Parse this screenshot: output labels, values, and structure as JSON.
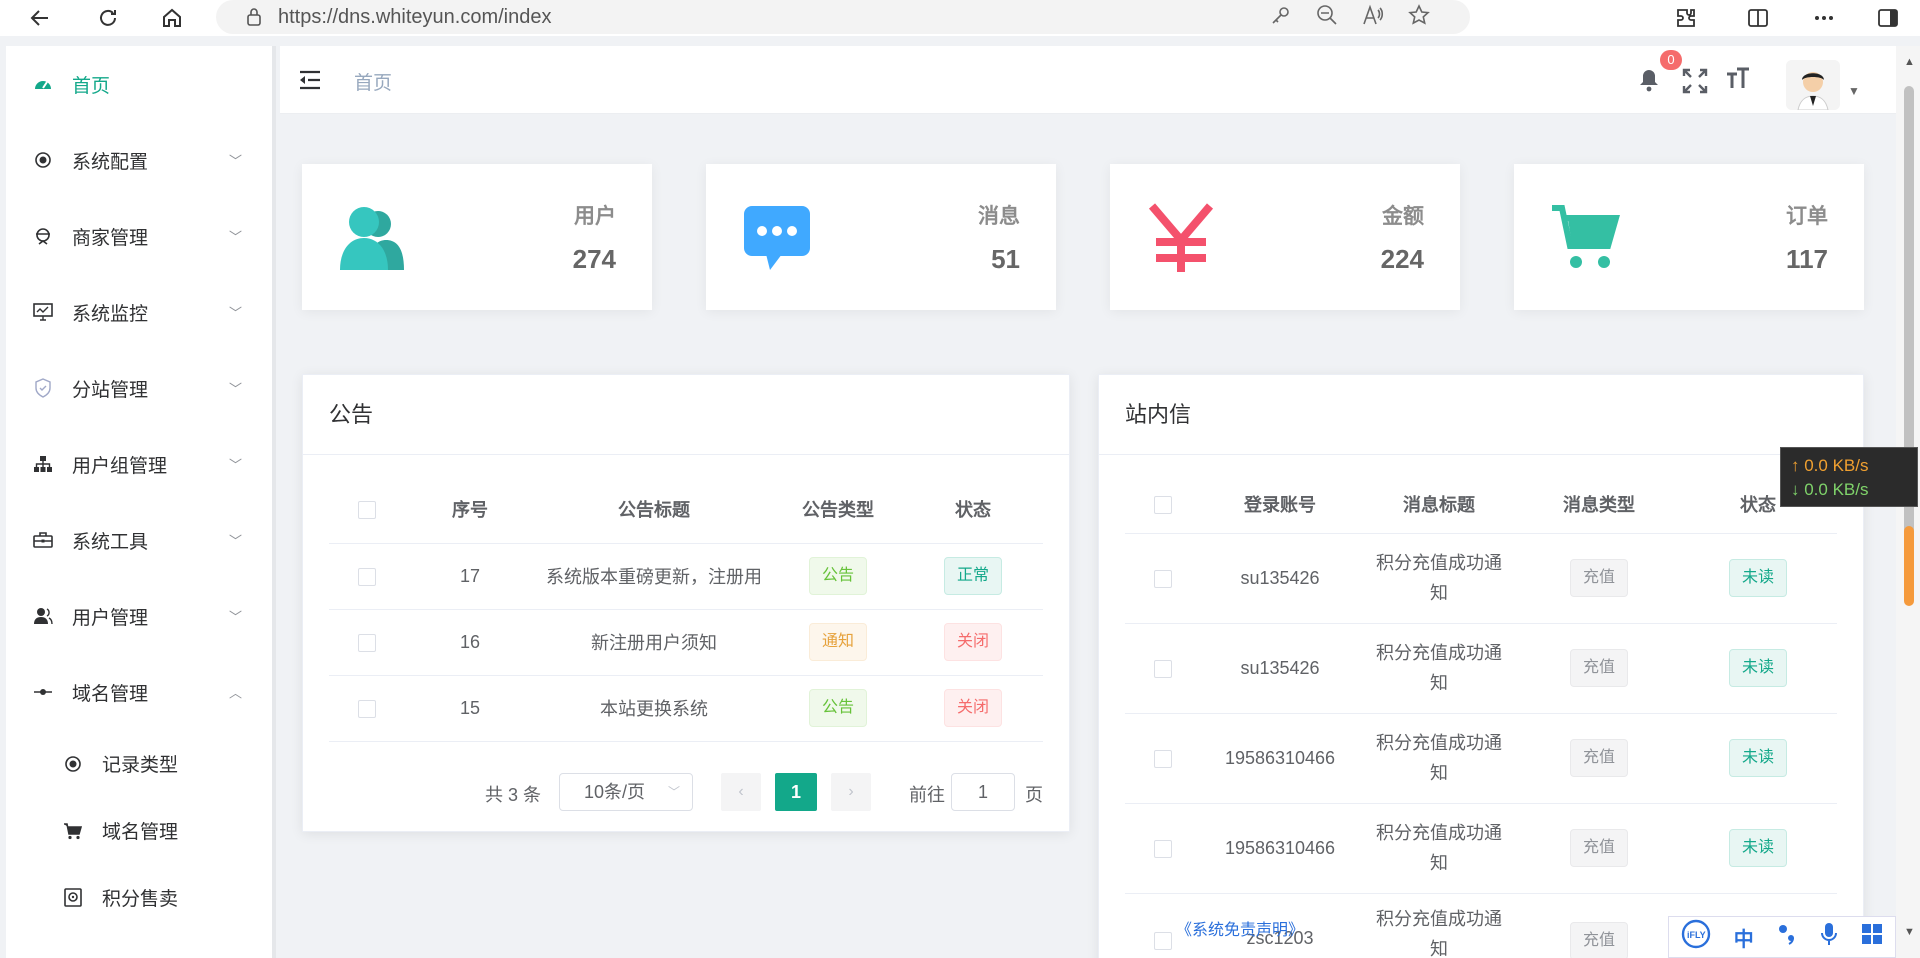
{
  "browser": {
    "url": "https://dns.whiteyun.com/index"
  },
  "sidebar": {
    "items": [
      {
        "label": "首页",
        "icon": "dashboard-icon",
        "active": true
      },
      {
        "label": "系统配置",
        "icon": "settings-dot-icon"
      },
      {
        "label": "商家管理",
        "icon": "merchant-icon"
      },
      {
        "label": "系统监控",
        "icon": "monitor-icon"
      },
      {
        "label": "分站管理",
        "icon": "shield-icon"
      },
      {
        "label": "用户组管理",
        "icon": "org-tree-icon"
      },
      {
        "label": "系统工具",
        "icon": "toolbox-icon"
      },
      {
        "label": "用户管理",
        "icon": "user-icon"
      },
      {
        "label": "域名管理",
        "icon": "domain-icon",
        "expanded": true
      }
    ],
    "subitems": [
      {
        "label": "记录类型",
        "icon": "radio-dot-icon"
      },
      {
        "label": "域名管理",
        "icon": "cart-icon"
      },
      {
        "label": "积分售卖",
        "icon": "safe-icon"
      }
    ]
  },
  "topbar": {
    "breadcrumb": "首页",
    "notification_count": "0"
  },
  "stats": [
    {
      "label": "用户",
      "value": "274",
      "icon": "users-icon",
      "color": "#36c6bf"
    },
    {
      "label": "消息",
      "value": "51",
      "icon": "message-icon",
      "color": "#40a9ff"
    },
    {
      "label": "金额",
      "value": "224",
      "icon": "yen-icon",
      "color": "#f4516c"
    },
    {
      "label": "订单",
      "value": "117",
      "icon": "shopping-cart-icon",
      "color": "#34bfa3"
    }
  ],
  "announcements": {
    "title": "公告",
    "columns": [
      "序号",
      "公告标题",
      "公告类型",
      "状态"
    ],
    "rows": [
      {
        "id": "17",
        "title": "系统版本重磅更新，注册用",
        "type": "公告",
        "status": "正常"
      },
      {
        "id": "16",
        "title": "新注册用户须知",
        "type": "通知",
        "status": "关闭"
      },
      {
        "id": "15",
        "title": "本站更换系统",
        "type": "公告",
        "status": "关闭"
      }
    ],
    "pager": {
      "total": "共 3 条",
      "page_size": "10条/页",
      "current": "1",
      "goto_label": "前往",
      "goto_value": "1",
      "page_label": "页"
    }
  },
  "messages": {
    "title": "站内信",
    "columns": [
      "登录账号",
      "消息标题",
      "消息类型",
      "状态"
    ],
    "rows": [
      {
        "account": "su135426",
        "title_line1": "积分充值成功通",
        "title_line2": "知",
        "type": "充值",
        "status": "未读"
      },
      {
        "account": "su135426",
        "title_line1": "积分充值成功通",
        "title_line2": "知",
        "type": "充值",
        "status": "未读"
      },
      {
        "account": "19586310466",
        "title_line1": "积分充值成功通",
        "title_line2": "知",
        "type": "充值",
        "status": "未读"
      },
      {
        "account": "19586310466",
        "title_line1": "积分充值成功通",
        "title_line2": "知",
        "type": "充值",
        "status": "未读"
      },
      {
        "account": "zsc1203",
        "title_line1": "积分充值成功通",
        "title_line2": "知",
        "type": "充值",
        "status": ""
      }
    ]
  },
  "netspeed": {
    "up": "↑ 0.0 KB/s",
    "down": "↓ 0.0 KB/s"
  },
  "disclaimer": "《系统免责声明》",
  "ime": {
    "label": "中"
  }
}
